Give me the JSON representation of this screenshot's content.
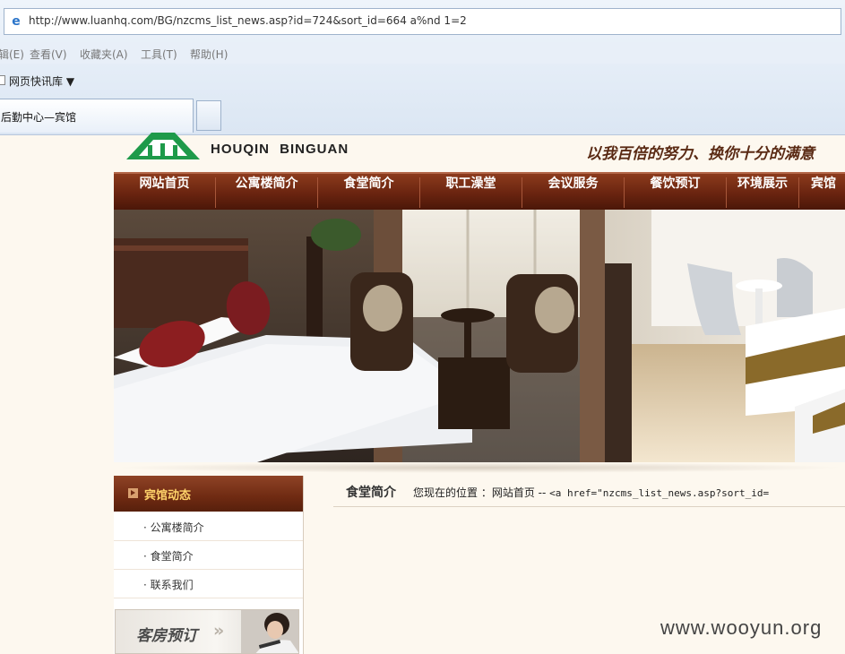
{
  "browser": {
    "address": "http://www.luanhq.com/BG/nzcms_list_news.asp?id=724&sort_id=664 a%nd 1=2",
    "menu": [
      "辑(E)",
      "查看(V)",
      "收藏夹(A)",
      "工具(T)",
      "帮助(H)"
    ],
    "favorites_label": "网页快讯库",
    "tab_title": "后勤中心—宾馆"
  },
  "site": {
    "brand": "HOUQIN  BINGUAN",
    "slogan": "以我百倍的努力、换你十分的满意",
    "nav": [
      "网站首页",
      "公寓楼简介",
      "食堂简介",
      "职工澡堂",
      "会议服务",
      "餐饮预订",
      "环境展示",
      "宾馆"
    ]
  },
  "sidebar": {
    "heading": "宾馆动态",
    "items": [
      "· 公寓楼简介",
      "· 食堂简介",
      "· 联系我们"
    ],
    "booking_label": "客房预订",
    "booking_arrows": "»"
  },
  "content": {
    "title": "食堂简介",
    "location_prefix": "您现在的位置 ：网站首页 -- ",
    "location_code": "<a href=\"nzcms_list_news.asp?sort_id="
  },
  "watermark": "www.wooyun.org",
  "colors": {
    "nav_bg": "#6a2410",
    "side_heading": "#ffd36a",
    "page_bg": "#fdf8ef"
  }
}
